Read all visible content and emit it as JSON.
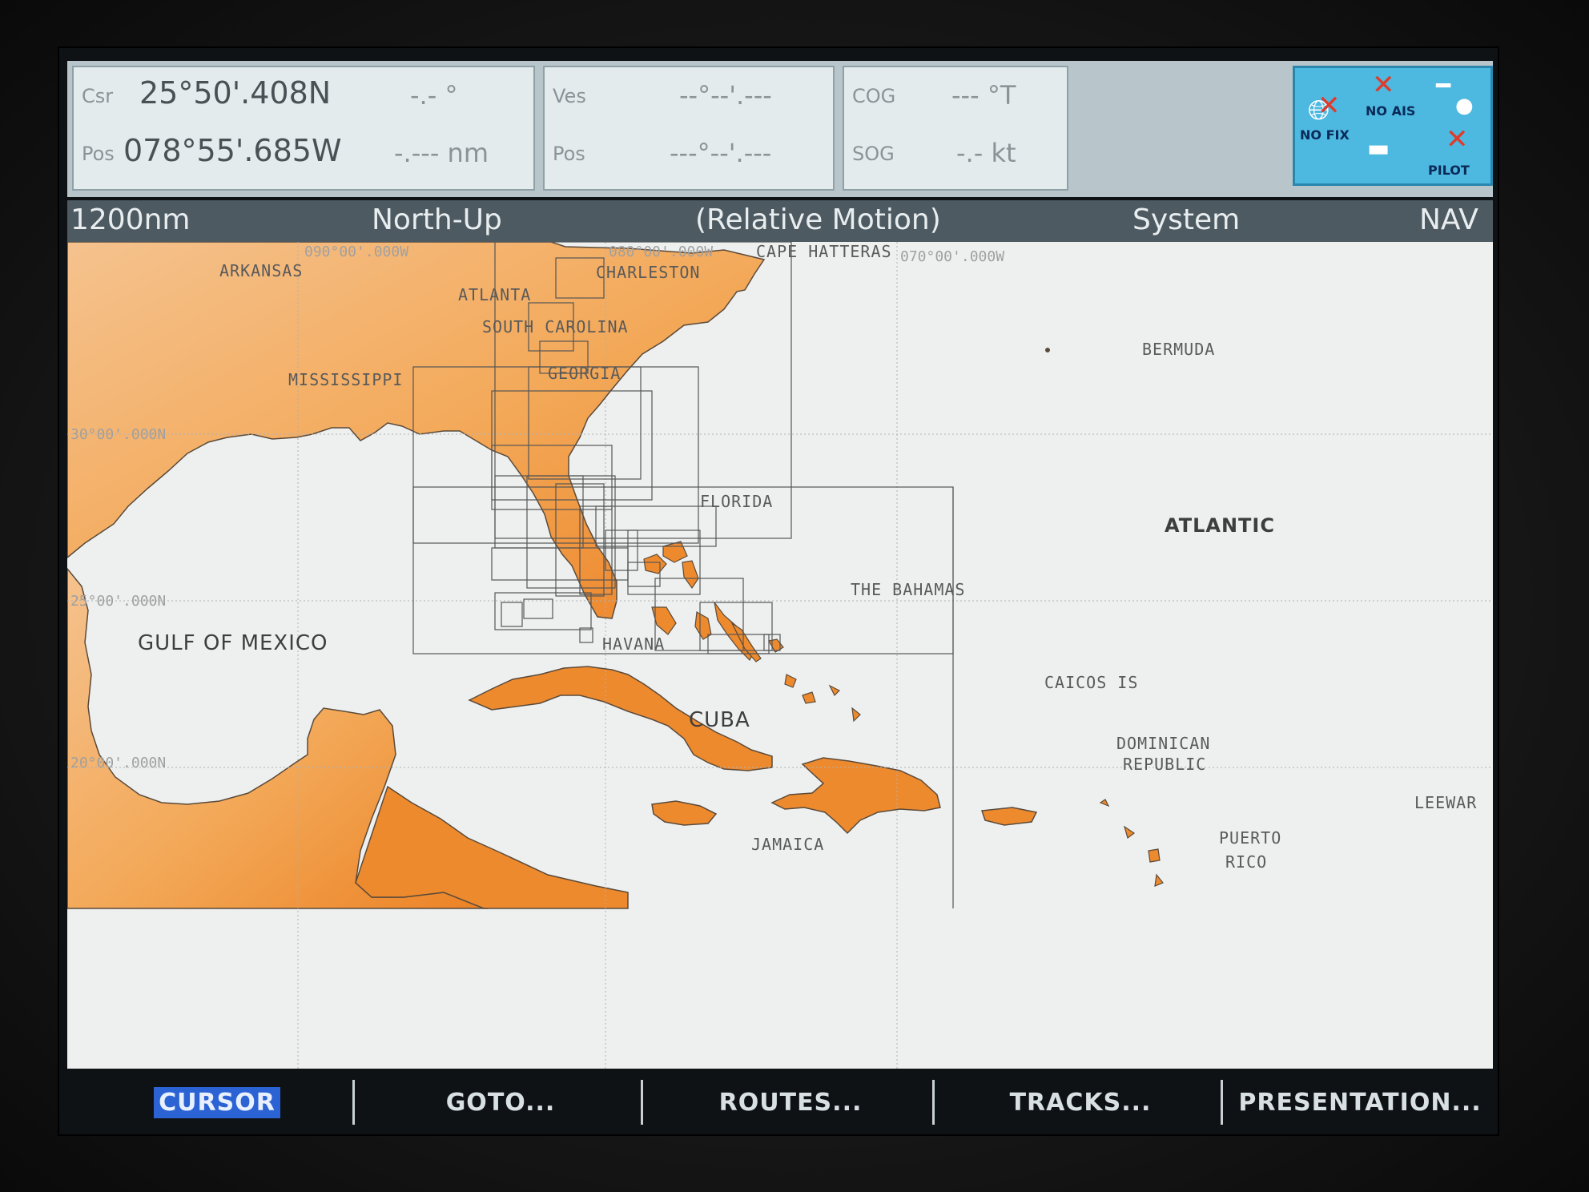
{
  "header": {
    "position_panel": {
      "csr_label": "Csr",
      "pos_label": "Pos",
      "latitude": "25°50'.408N",
      "longitude": "078°55'.685W",
      "bearing": "-.- °",
      "range": "-.--- nm"
    },
    "vessel_panel": {
      "ves_label": "Ves",
      "pos_label": "Pos",
      "latitude": "--°--'.---",
      "longitude": "---°--'.---"
    },
    "course_panel": {
      "cog_label": "COG",
      "sog_label": "SOG",
      "cog_value": "--- °T",
      "sog_value": "-.- kt"
    },
    "status": {
      "no_fix": "NO FIX",
      "no_ais": "NO AIS",
      "pilot": "PILOT"
    }
  },
  "status_bar": {
    "range": "1200nm",
    "orientation": "North-Up",
    "motion": "(Relative Motion)",
    "menu": "System",
    "mode": "NAV"
  },
  "map": {
    "gridlines": {
      "lon_90": "090°00'.000W",
      "lon_80": "080°00'.000W",
      "lon_70": "070°00'.000W",
      "lat_30": "30°00'.000N",
      "lat_25": "25°00'.000N",
      "lat_20": "20°00'.000N"
    },
    "labels": {
      "arkansas": "ARKANSAS",
      "atlanta": "ATLANTA",
      "charleston": "CHARLESTON",
      "cape_hatteras": "CAPE HATTERAS",
      "south_carolina": "SOUTH CAROLINA",
      "georgia": "GEORGIA",
      "mississippi": "MISSISSIPPI",
      "bermuda": "BERMUDA",
      "florida": "FLORIDA",
      "atlantic": "ATLANTIC",
      "the_bahamas": "THE BAHAMAS",
      "gulf_of_mexico": "GULF OF MEXICO",
      "havana": "HAVANA",
      "caicos_is": "CAICOS IS",
      "cuba": "CUBA",
      "dominican": "DOMINICAN",
      "republic": "REPUBLIC",
      "leewar": "LEEWAR",
      "jamaica": "JAMAICA",
      "puerto": "PUERTO",
      "rico": "RICO"
    },
    "colors": {
      "water": "#eef0f0",
      "land_dark": "#ee8a2e",
      "land_light": "#f6c08a",
      "grid": "#b0b0b0",
      "chart_outline": "#555555"
    }
  },
  "softkeys": {
    "cursor": "CURSOR",
    "goto": "GOTO...",
    "routes": "ROUTES...",
    "tracks": "TRACKS...",
    "presentation": "PRESENTATION..."
  }
}
